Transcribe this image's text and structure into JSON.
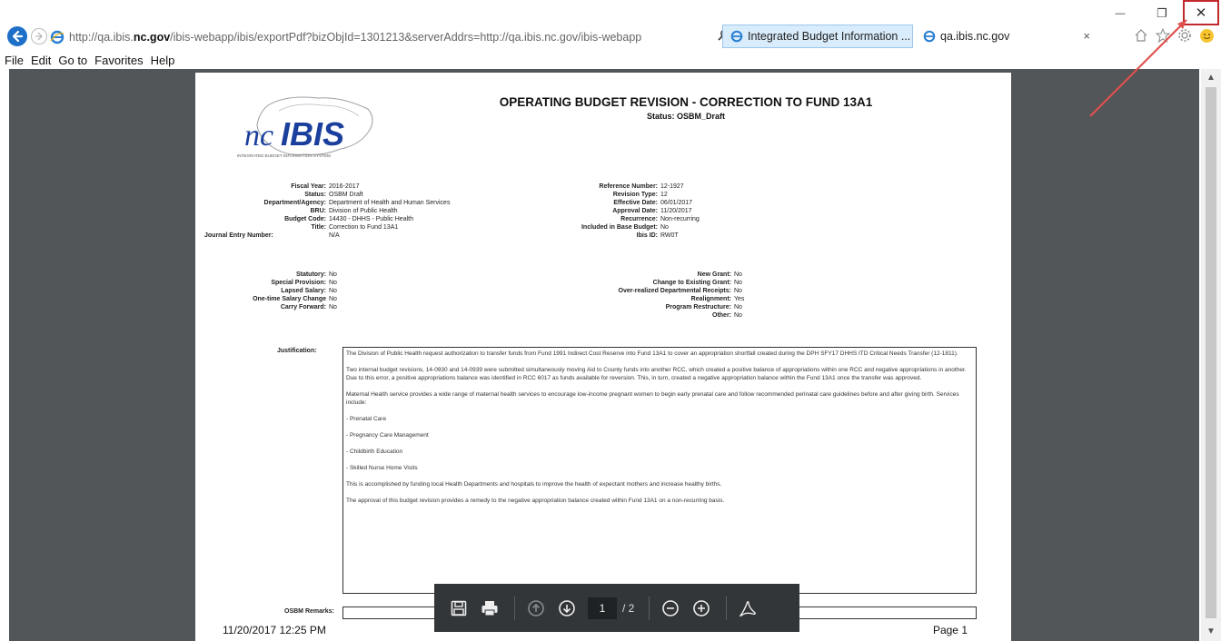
{
  "browser": {
    "url_pre": "http://qa.ibis.",
    "url_host": "nc.gov",
    "url_post": "/ibis-webapp/ibis/exportPdf?bizObjId=1301213&serverAddrs=http://qa.ibis.nc.gov/ibis-webapp",
    "tabs": [
      {
        "label": "Integrated Budget Information ..."
      },
      {
        "label": "qa.ibis.nc.gov"
      }
    ],
    "tab_close": "×",
    "window_controls": {
      "minimize": "—",
      "restore": "❐",
      "close": "✕"
    },
    "icons": [
      "back-arrow-icon",
      "forward-arrow-icon",
      "ie-logo-icon",
      "search-icon",
      "refresh-icon",
      "home-icon",
      "favorites-star-icon",
      "settings-gear-icon",
      "smiley-feedback-icon"
    ]
  },
  "menu": {
    "items": [
      "File",
      "Edit",
      "Go to",
      "Favorites",
      "Help"
    ]
  },
  "document": {
    "logo_text": "ncIBIS",
    "logo_tagline": "INTEGRATED BUDGET INFORMATION SYSTEM",
    "title": "OPERATING BUDGET REVISION -  CORRECTION TO FUND 13A1",
    "status_line": "Status: OSBM_Draft",
    "left_fields": [
      {
        "label": "Fiscal Year:",
        "value": "2016-2017"
      },
      {
        "label": "Status:",
        "value": "OSBM Draft"
      },
      {
        "label": "Department/Agency:",
        "value": "Department of Health and Human Services"
      },
      {
        "label": "BRU:",
        "value": "Division of Public Health"
      },
      {
        "label": "Budget Code:",
        "value": "14430 - DHHS - Public Health"
      },
      {
        "label": "Title:",
        "value": "Correction to Fund 13A1"
      },
      {
        "label": "Journal Entry Number:",
        "value": "N/A"
      }
    ],
    "right_fields": [
      {
        "label": "Reference Number:",
        "value": "12-1927"
      },
      {
        "label": "Revision Type:",
        "value": "12"
      },
      {
        "label": "Effective Date:",
        "value": "06/01/2017"
      },
      {
        "label": "Approval Date:",
        "value": "11/20/2017"
      },
      {
        "label": "Recurrence:",
        "value": "Non-recurring"
      },
      {
        "label": "Included in Base Budget:",
        "value": "No"
      },
      {
        "label": "Ibis ID:",
        "value": "RW0T"
      }
    ],
    "left_flags": [
      {
        "label": "Statutory:",
        "value": "No"
      },
      {
        "label": "Special Provision:",
        "value": "No"
      },
      {
        "label": "Lapsed Salary:",
        "value": "No"
      },
      {
        "label": "One-time Salary Change",
        "value": "No"
      },
      {
        "label": "Carry Forward:",
        "value": "No"
      }
    ],
    "right_flags": [
      {
        "label": "New Grant:",
        "value": "No"
      },
      {
        "label": "Change to Existing Grant:",
        "value": "No"
      },
      {
        "label": "Over-realized Departmental Receipts:",
        "value": "No"
      },
      {
        "label": "Realignment:",
        "value": "Yes"
      },
      {
        "label": "Program Restructure:",
        "value": "No"
      },
      {
        "label": "Other:",
        "value": "No"
      }
    ],
    "justification_label": "Justification:",
    "justification_paragraphs": [
      "The Division of Public Health request authorization to transfer funds from Fund 1991 Indirect Cost Reserve into Fund 13A1 to cover an appropriation shortfall created during the DPH SFY17 DHHS ITD Critical Needs Transfer (12-1811).",
      "Two internal budget revisions, 14-0930 and 14-0939 were submitted simultaneously moving Aid to County funds into another RCC, which created a positive balance of appropriations within one RCC and negative appropriations in another.  Due to this error, a positive appropriations balance was identified in RCC 6017 as funds available for reversion. This, in turn, created a negative appropriation balance within the Fund 13A1 once the transfer was approved.",
      "Maternal Health service provides a wide range of maternal health services to encourage low-income pregnant women to begin early prenatal care and follow recommended perinatal care guidelines before and after giving birth. Services include:",
      "- Prenatal Care",
      "- Pregnancy Care Management",
      "- Childbirth Education",
      "- Skilled Nurse Home Visits",
      "This is accomplished by funding local Health Departments and hospitals to improve the health of expectant mothers and increase healthy births.",
      "The approval of this budget revision provides a remedy to the negative appropriation balance created within Fund 13A1 on a non-recurring basis."
    ],
    "osbm_remarks_label": "OSBM Remarks:",
    "footer_date": "11/20/2017 12:25 PM",
    "footer_page": "Page 1"
  },
  "pdf_toolbar": {
    "current_page": "1",
    "total_pages": "/ 2",
    "icons": [
      "save-icon",
      "print-icon",
      "page-up-icon",
      "page-down-icon",
      "zoom-out-icon",
      "zoom-in-icon",
      "adobe-acrobat-icon"
    ]
  },
  "colors": {
    "viewer_bg": "#525659",
    "toolbar_bg": "#323639",
    "close_highlight": "#c0282d",
    "logo_blue": "#1a3f9c"
  }
}
